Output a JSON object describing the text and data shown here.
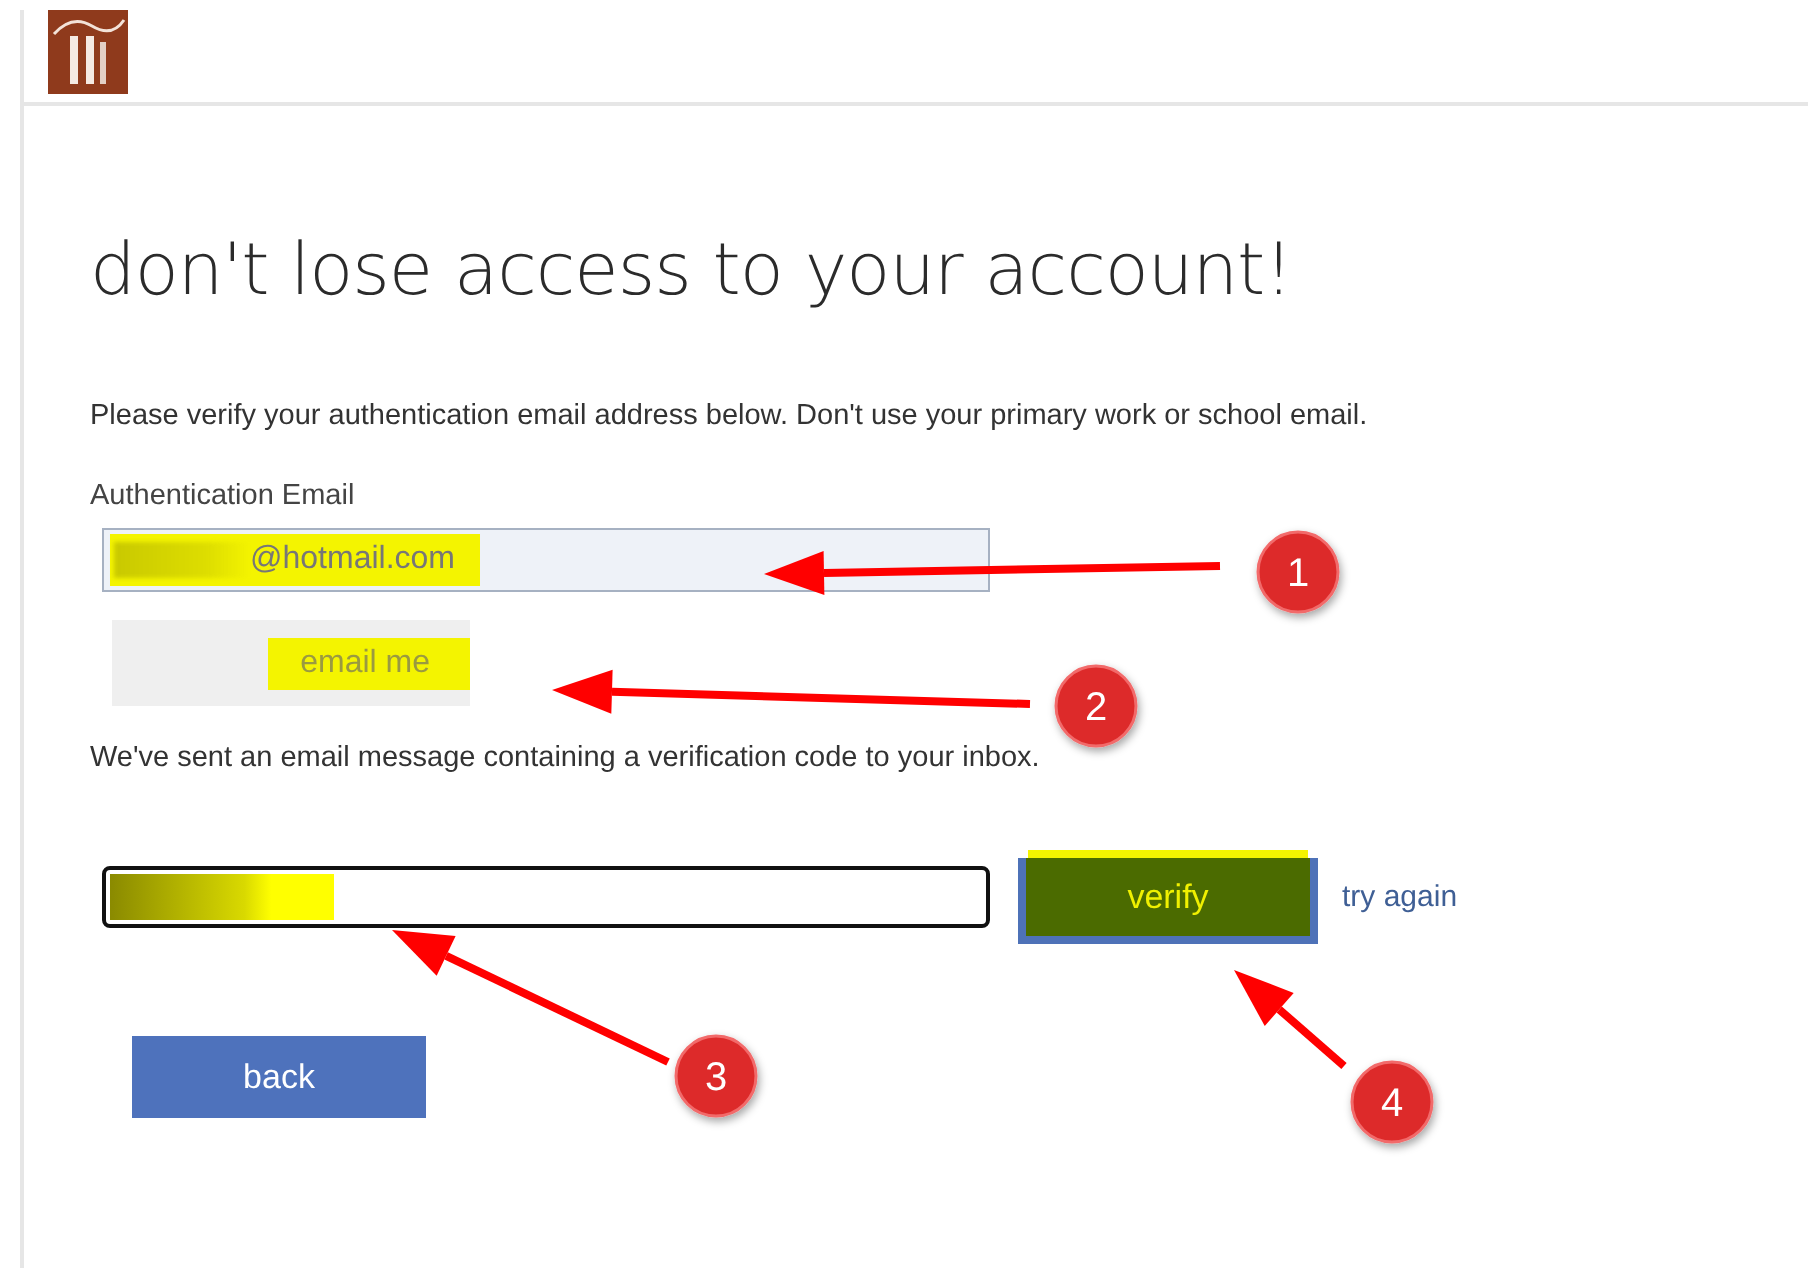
{
  "header": {
    "logo": true
  },
  "title": "don't lose access to your account!",
  "instructions": "Please verify your authentication email address below. Don't use your primary work or school email.",
  "email_field": {
    "label": "Authentication Email",
    "value": "@hotmail.com",
    "highlighted": true,
    "redacted": true
  },
  "email_button": {
    "label": "email me",
    "highlighted": true
  },
  "message": "We've sent an email message containing a verification code to your inbox.",
  "code_field": {
    "highlighted": true,
    "redacted": true
  },
  "verify_button": {
    "label": "verify",
    "highlighted": true
  },
  "try_again_link": "try again",
  "back_button": "back",
  "annotations": [
    {
      "label": "1"
    },
    {
      "label": "2"
    },
    {
      "label": "3"
    },
    {
      "label": "4"
    }
  ]
}
